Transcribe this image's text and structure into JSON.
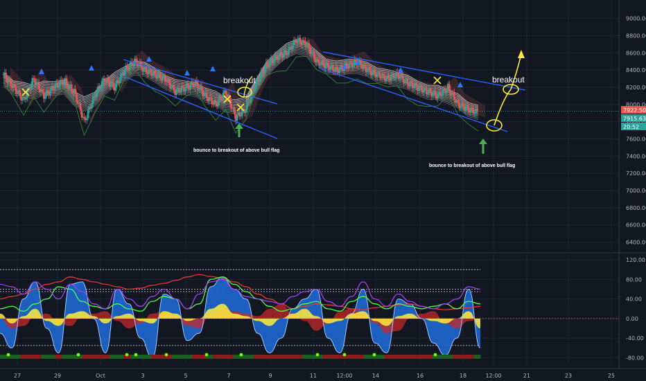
{
  "chart_data": [
    {
      "type": "candlestick",
      "title": "",
      "y_ticks": [
        6400,
        6600,
        6800,
        7000,
        7200,
        7400,
        7600,
        7800,
        8000,
        8200,
        8400,
        8600,
        8800,
        9000
      ],
      "ylim": [
        6300,
        9150
      ],
      "price_badges": [
        {
          "text": "7922.50",
          "color": "#ef5350"
        },
        {
          "text": "7915.63",
          "color": "#26a69a"
        },
        {
          "text": "20:52",
          "color": "#26a69a"
        }
      ],
      "annotations": [
        {
          "text": "breakout"
        },
        {
          "text": "breakout"
        },
        {
          "text": "bounce to breakout of above bull flag"
        },
        {
          "text": "bounce to breakout of above bull flag"
        }
      ],
      "price_path": [
        8350,
        8200,
        8050,
        8300,
        8100,
        8200,
        8280,
        8150,
        7800,
        8100,
        8300,
        8200,
        8400,
        8500,
        8400,
        8350,
        8300,
        8150,
        8200,
        8250,
        8100,
        8000,
        8150,
        7850,
        7950,
        8250,
        8450,
        8550,
        8600,
        8750,
        8700,
        8500,
        8450,
        8400,
        8450,
        8500,
        8400,
        8350,
        8300,
        8350,
        8250,
        8200,
        8150,
        8100,
        8200,
        8000,
        7950,
        7900
      ]
    },
    {
      "type": "line",
      "title": "",
      "y_ticks": [
        -80,
        -40,
        0,
        40,
        80,
        120
      ],
      "y_tick_labels": [
        "-80.00",
        "-40.00",
        "0.00",
        "40.00",
        "80.00",
        "120.00"
      ],
      "ylim": [
        -95,
        130
      ],
      "series": [
        {
          "color": "#1e63c8",
          "values": [
            -30,
            -60,
            40,
            75,
            -20,
            -70,
            70,
            75,
            0,
            -70,
            60,
            30,
            -40,
            -80,
            50,
            40,
            -45,
            -30,
            65,
            85,
            60,
            40,
            -30,
            -70,
            -40,
            20,
            40,
            60,
            -40,
            -70,
            10,
            60,
            -50,
            -70,
            40,
            30,
            0,
            -50,
            -75,
            -40,
            60,
            -60
          ]
        },
        {
          "color": "#c62828",
          "values": [
            0,
            -20,
            -15,
            5,
            10,
            -10,
            -15,
            5,
            10,
            15,
            -5,
            -20,
            -10,
            10,
            15,
            5,
            -15,
            -20,
            10,
            20,
            15,
            10,
            5,
            20,
            30,
            10,
            -5,
            -25,
            -10,
            15,
            20,
            10,
            -10,
            -30,
            -25,
            0,
            10,
            15,
            -10,
            -20,
            -5,
            0
          ]
        },
        {
          "color": "#ffeb3b",
          "values": [
            10,
            -10,
            5,
            20,
            -5,
            -15,
            10,
            15,
            5,
            -10,
            5,
            10,
            -5,
            -10,
            15,
            10,
            -5,
            0,
            20,
            30,
            10,
            5,
            -5,
            -15,
            0,
            10,
            20,
            5,
            -10,
            -5,
            10,
            15,
            -5,
            -15,
            5,
            10,
            0,
            -5,
            -10,
            0,
            15,
            -20
          ]
        },
        {
          "color": "#e53935",
          "values": [
            40,
            45,
            50,
            60,
            70,
            75,
            85,
            80,
            75,
            70,
            65,
            60,
            62,
            68,
            72,
            78,
            85,
            90,
            86,
            82,
            75,
            65,
            50,
            40,
            30,
            20,
            25,
            30,
            28,
            25,
            20,
            18,
            22,
            25,
            28,
            30,
            25,
            20,
            18,
            20,
            22,
            25
          ]
        },
        {
          "color": "#4cff4c",
          "values": [
            20,
            25,
            15,
            30,
            40,
            65,
            60,
            35,
            25,
            20,
            30,
            20,
            15,
            35,
            45,
            40,
            20,
            30,
            80,
            85,
            70,
            55,
            40,
            25,
            15,
            20,
            30,
            35,
            20,
            15,
            35,
            45,
            30,
            20,
            30,
            25,
            20,
            25,
            30,
            20,
            35,
            30
          ]
        },
        {
          "color": "#a142f4",
          "values": [
            70,
            65,
            50,
            75,
            60,
            40,
            70,
            55,
            30,
            20,
            60,
            40,
            25,
            45,
            60,
            40,
            20,
            50,
            75,
            80,
            60,
            45,
            40,
            35,
            30,
            45,
            55,
            60,
            35,
            25,
            45,
            75,
            40,
            25,
            50,
            35,
            25,
            20,
            30,
            40,
            65,
            60
          ]
        }
      ]
    }
  ],
  "x_axis": {
    "tick_labels": [
      "27",
      "29",
      "Oct",
      "3",
      "5",
      "7",
      "9",
      "11",
      "12:00",
      "14",
      "16",
      "18",
      "12:00",
      "21",
      "23",
      "25"
    ]
  }
}
